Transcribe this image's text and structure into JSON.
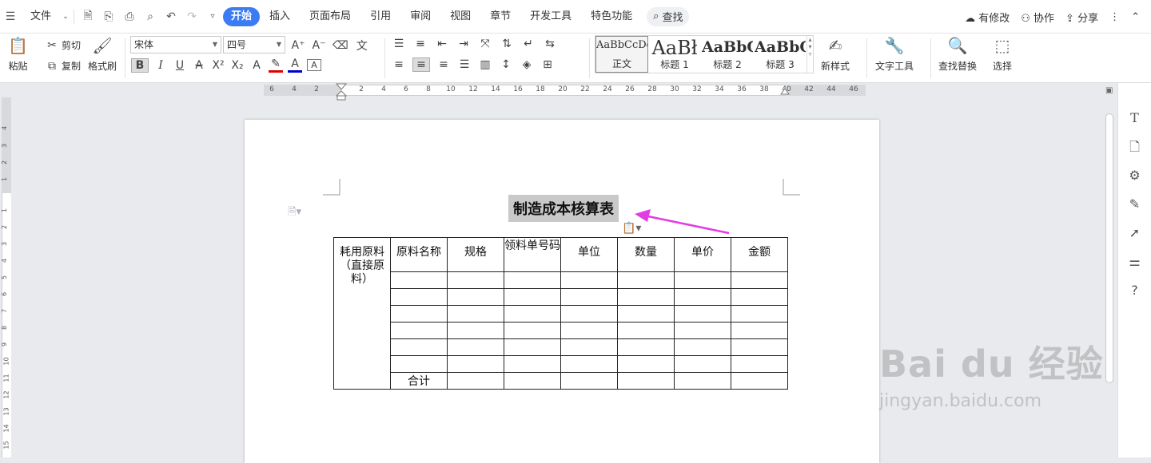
{
  "menu": {
    "file": "文件",
    "tabs": [
      "开始",
      "插入",
      "页面布局",
      "引用",
      "审阅",
      "视图",
      "章节",
      "开发工具",
      "特色功能"
    ],
    "search": "查找",
    "right": {
      "modified": "有修改",
      "collab": "协作",
      "share": "分享"
    }
  },
  "toolbar": {
    "paste": "粘贴",
    "cut": "剪切",
    "copy": "复制",
    "format_painter": "格式刷",
    "font_name": "宋体",
    "font_size": "四号",
    "styles": [
      {
        "preview": "AaBbCcDd",
        "label": "正文"
      },
      {
        "preview": "AaBł",
        "label": "标题 1"
      },
      {
        "preview": "AaBbC",
        "label": "标题 2"
      },
      {
        "preview": "AaBbC",
        "label": "标题 3"
      }
    ],
    "new_style": "新样式",
    "text_tools": "文字工具",
    "find_replace": "查找替换",
    "select": "选择"
  },
  "ruler": {
    "h_left": [
      "6",
      "4",
      "2"
    ],
    "h_right": [
      "2",
      "4",
      "6",
      "8",
      "10",
      "12",
      "14",
      "16",
      "18",
      "20",
      "22",
      "24",
      "26",
      "28",
      "30",
      "32",
      "34",
      "36",
      "38",
      "40",
      "42",
      "44",
      "46"
    ],
    "v_top": [
      "4",
      "3",
      "2",
      "1"
    ],
    "v_body": [
      "1",
      "2",
      "3",
      "4",
      "5",
      "6",
      "7",
      "8",
      "9",
      "10",
      "11",
      "12",
      "13",
      "14",
      "15"
    ]
  },
  "document": {
    "title": "制造成本核算表",
    "table": {
      "row_header": "耗用原料（直接原料）",
      "headers": [
        "原料名称",
        "规格",
        "领料单号码",
        "单位",
        "数量",
        "单价",
        "金额"
      ],
      "total_label": "合计"
    }
  },
  "watermark": {
    "brand": "Bai du 经验",
    "url": "jingyan.baidu.com"
  },
  "colors": {
    "accent": "#3b7cf5",
    "arrow": "#e23ce6",
    "title_highlight": "#c9c9c9"
  }
}
